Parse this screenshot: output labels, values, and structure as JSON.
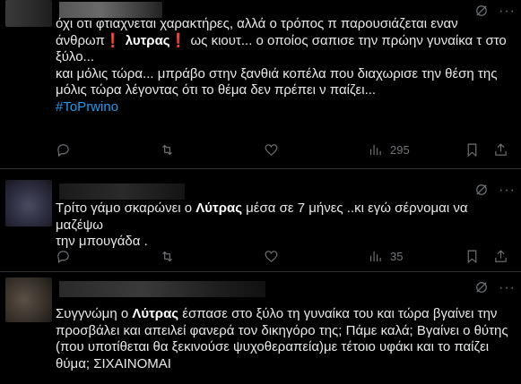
{
  "tweets": [
    {
      "lines": {
        "l1": "όχι οτι φτιαχνεται χαρακτήρες, αλλά ο τρόπος π παρουσιάζεται εναν",
        "l2_pre": "άνθρωπ",
        "l2_mark1": "❗",
        "l2_name": "λυτρας",
        "l2_mark2": "❗",
        "l2_post": "ως κιουτ... ο οποίος σαπισε την πρώην γυναίκα τ στο",
        "l3": "ξύλο...",
        "l4": "και μόλις τώρα... μπράβο στην ξανθιά κοπέλα που διαχωρισε την θέση της",
        "l5": "μόλις τώρα λέγοντας ότι το θέμα δεν πρέπει ν παίζει...",
        "hashtag": "#ToPrwino"
      },
      "actions": {
        "reply_icon": "reply-icon",
        "retweet_icon": "retweet-icon",
        "like_icon": "heart-icon",
        "views_icon": "views-chart-icon",
        "views_count": "295",
        "bookmark_icon": "bookmark-icon",
        "share_icon": "share-icon"
      }
    },
    {
      "lines": {
        "l1_pre": "Τρίτο γάμο σκαρώνει ο ",
        "l1_name": "Λύτρας",
        "l1_post": " μέσα σε 7 μήνες ..κι εγώ σέρνομαι να μαζέψω",
        "l2": "την μπουγάδα ."
      },
      "actions": {
        "reply_icon": "reply-icon",
        "retweet_icon": "retweet-icon",
        "like_icon": "heart-icon",
        "views_icon": "views-chart-icon",
        "views_count": "35",
        "bookmark_icon": "bookmark-icon",
        "share_icon": "share-icon"
      }
    },
    {
      "lines": {
        "l1_pre": "Συγγνώμη ο ",
        "l1_name": "Λύτρας",
        "l1_post": " έσπασε στο ξύλο τη γυναίκα του και τώρα βγαίνει την",
        "l2": "προσβάλει και απειλεί φανερά τον δικηγόρο της; Πάμε καλά; Βγαίνει ο θύτης",
        "l3": "(που υποτίθεται θα ξεκινούσε ψυχοθεραπεία)με τέτοιο υφάκι και το παίζει",
        "l4": "θύμα; ΣΙΧΑΙΝΟΜΑΙ"
      }
    }
  ],
  "colors": {
    "background": "#000000",
    "text": "#e7e9ea",
    "muted": "#71767b",
    "link": "#1d9bf0",
    "divider": "#2f3336"
  }
}
